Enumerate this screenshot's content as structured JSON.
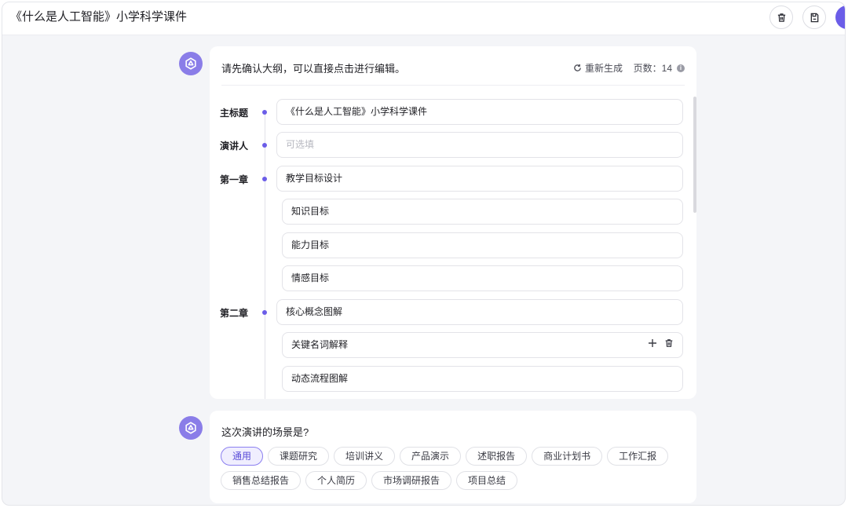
{
  "header": {
    "title": "《什么是人工智能》小学科学课件"
  },
  "outline": {
    "prompt": "请先确认大纲，可以直接点击进行编辑。",
    "regenerate_label": "重新生成",
    "pages_label": "页数：14",
    "rows": [
      {
        "label": "主标题",
        "value": "《什么是人工智能》小学科学课件",
        "level": 0
      },
      {
        "label": "演讲人",
        "placeholder": "可选填",
        "level": 0
      },
      {
        "label": "第一章",
        "value": "教学目标设计",
        "level": 0
      },
      {
        "label": "",
        "value": "知识目标",
        "level": 1
      },
      {
        "label": "",
        "value": "能力目标",
        "level": 1
      },
      {
        "label": "",
        "value": "情感目标",
        "level": 1
      },
      {
        "label": "第二章",
        "value": "核心概念图解",
        "level": 0
      },
      {
        "label": "",
        "value": "关键名词解释",
        "level": 1
      },
      {
        "label": "",
        "value": "动态流程图解",
        "level": 1
      }
    ]
  },
  "scene": {
    "question": "这次演讲的场景是?",
    "chips": [
      "通用",
      "课题研究",
      "培训讲义",
      "产品演示",
      "述职报告",
      "商业计划书",
      "工作汇报",
      "销售总结报告",
      "个人简历",
      "市场调研报告",
      "项目总结"
    ],
    "selected": "通用"
  },
  "icons": {
    "header_delete": "trash-icon",
    "header_save": "save-icon",
    "regenerate": "refresh-icon",
    "info": "info-icon",
    "bot": "bot-logo-icon",
    "row_add": "plus-icon",
    "row_delete": "trash-icon"
  },
  "colors": {
    "accent": "#6b5de8",
    "background": "#f4f5f8"
  }
}
